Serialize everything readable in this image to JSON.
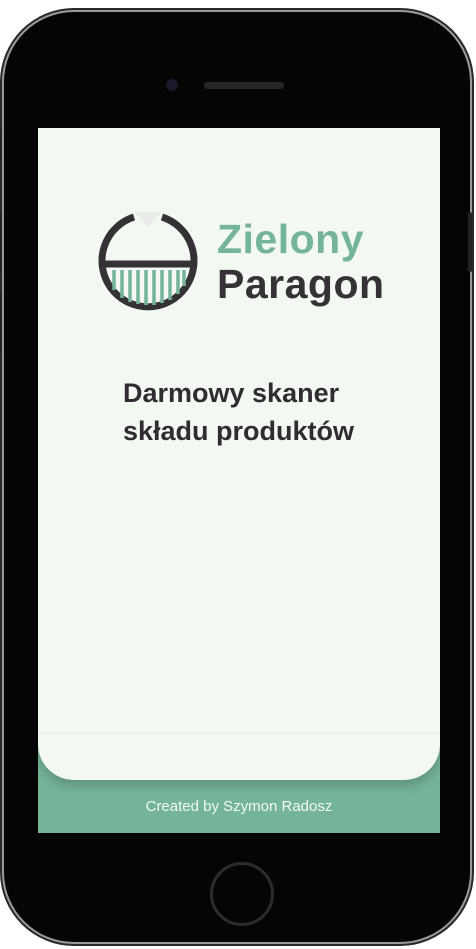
{
  "brand": {
    "line1": "Zielony",
    "line2": "Paragon"
  },
  "tagline": {
    "line1": "Darmowy skaner",
    "line2": "składu produktów"
  },
  "footer": {
    "credit": "Created by Szymon Radosz"
  },
  "colors": {
    "accent": "#74b49a",
    "background": "#f3f8f2",
    "text": "#333333"
  },
  "icons": {
    "logo": "receipt-scanner-logo"
  }
}
